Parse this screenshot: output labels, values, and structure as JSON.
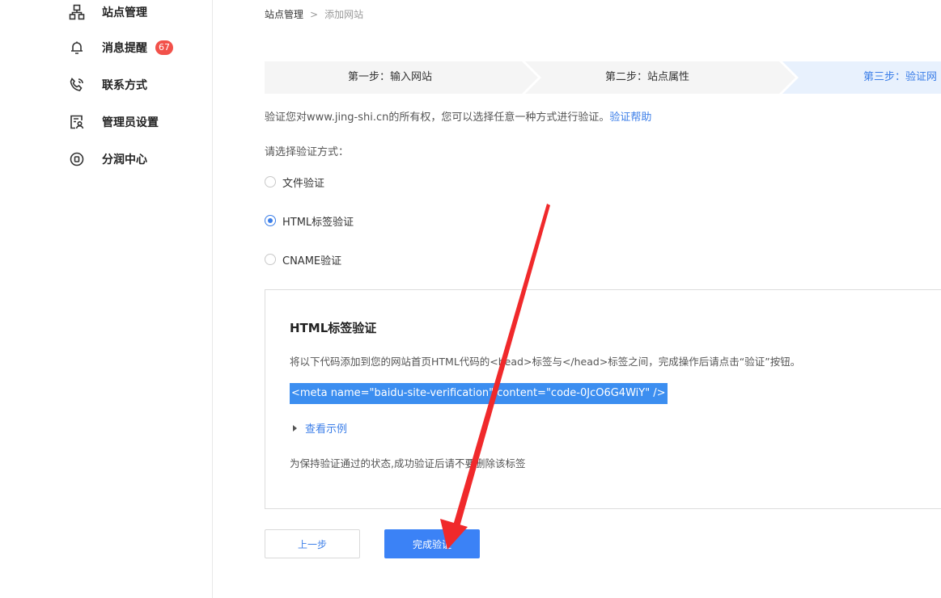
{
  "sidebar": {
    "items": [
      {
        "label": "站点管理",
        "icon": "sitemap-icon"
      },
      {
        "label": "消息提醒",
        "icon": "bell-icon",
        "badge": "67"
      },
      {
        "label": "联系方式",
        "icon": "phone-icon"
      },
      {
        "label": "管理员设置",
        "icon": "admin-user-icon"
      },
      {
        "label": "分润中心",
        "icon": "coin-icon"
      }
    ]
  },
  "breadcrumb": {
    "root": "站点管理",
    "current": "添加网站"
  },
  "steps": [
    {
      "label": "第一步：输入网站",
      "active": false
    },
    {
      "label": "第二步：站点属性",
      "active": false
    },
    {
      "label": "第三步：验证网",
      "active": true
    }
  ],
  "description": {
    "text": "验证您对www.jing-shi.cn的所有权，您可以选择任意一种方式进行验证。",
    "help_link": "验证帮助"
  },
  "choose_label": "请选择验证方式：",
  "methods": [
    {
      "label": "文件验证",
      "selected": false
    },
    {
      "label": "HTML标签验证",
      "selected": true
    },
    {
      "label": "CNAME验证",
      "selected": false
    }
  ],
  "panel": {
    "title": "HTML标签验证",
    "description": "将以下代码添加到您的网站首页HTML代码的<head>标签与</head>标签之间，完成操作后请点击“验证”按钮。",
    "code": "<meta name=\"baidu-site-verification\" content=\"code-0JcO6G4WiY\" />",
    "example_link": "查看示例",
    "note": "为保持验证通过的状态,成功验证后请不要删除该标签"
  },
  "buttons": {
    "prev": "上一步",
    "done": "完成验证"
  },
  "colors": {
    "accent": "#3b7ee8",
    "badge": "#f2514a",
    "annotation_arrow": "#f0292b",
    "active_step_bg": "#e8f1fd"
  }
}
